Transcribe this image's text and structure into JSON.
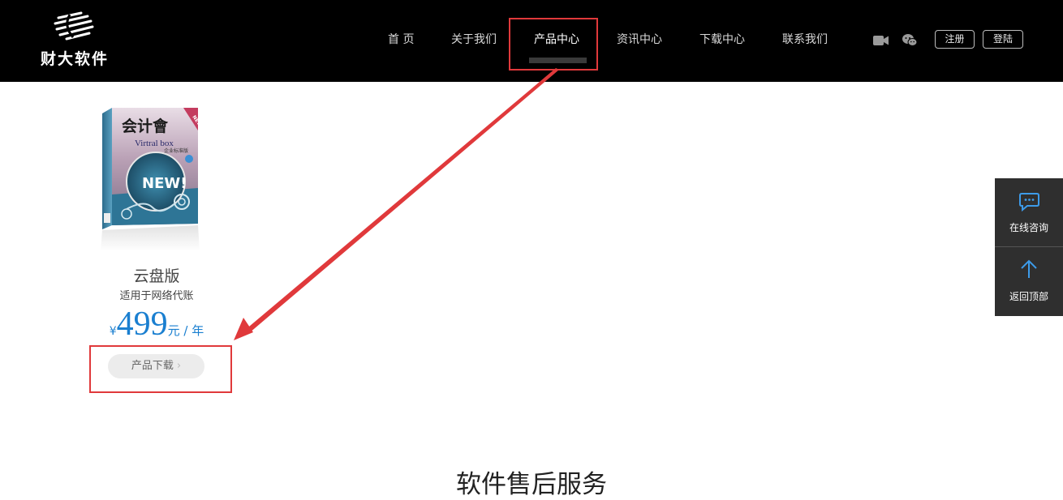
{
  "brand": {
    "name": "财大软件"
  },
  "nav": {
    "items": [
      {
        "label": "首 页"
      },
      {
        "label": "关于我们"
      },
      {
        "label": "产品中心"
      },
      {
        "label": "资讯中心"
      },
      {
        "label": "下载中心"
      },
      {
        "label": "联系我们"
      }
    ],
    "active": "产品中心"
  },
  "header": {
    "icons": [
      "video-camera-icon",
      "wechat-icon"
    ],
    "register_label": "注册",
    "login_label": "登陆"
  },
  "product": {
    "box_title": "会计會",
    "box_subtitle": "Virtral box",
    "box_edition": "企业标准版",
    "box_badge": "NEW!",
    "box_corner": "NEW",
    "name": "云盘版",
    "description": "适用于网络代账",
    "price_currency": "¥",
    "price_value": "499",
    "price_unit": "元 / 年",
    "download_label": "产品下载"
  },
  "side_panel": {
    "consult_label": "在线咨询",
    "top_label": "返回顶部"
  },
  "section": {
    "title": "软件售后服务"
  },
  "colors": {
    "header_bg": "#000000",
    "accent_blue": "#1a7fd0",
    "annotation_red": "#e0393b",
    "side_panel_bg": "#2f2f2f"
  }
}
